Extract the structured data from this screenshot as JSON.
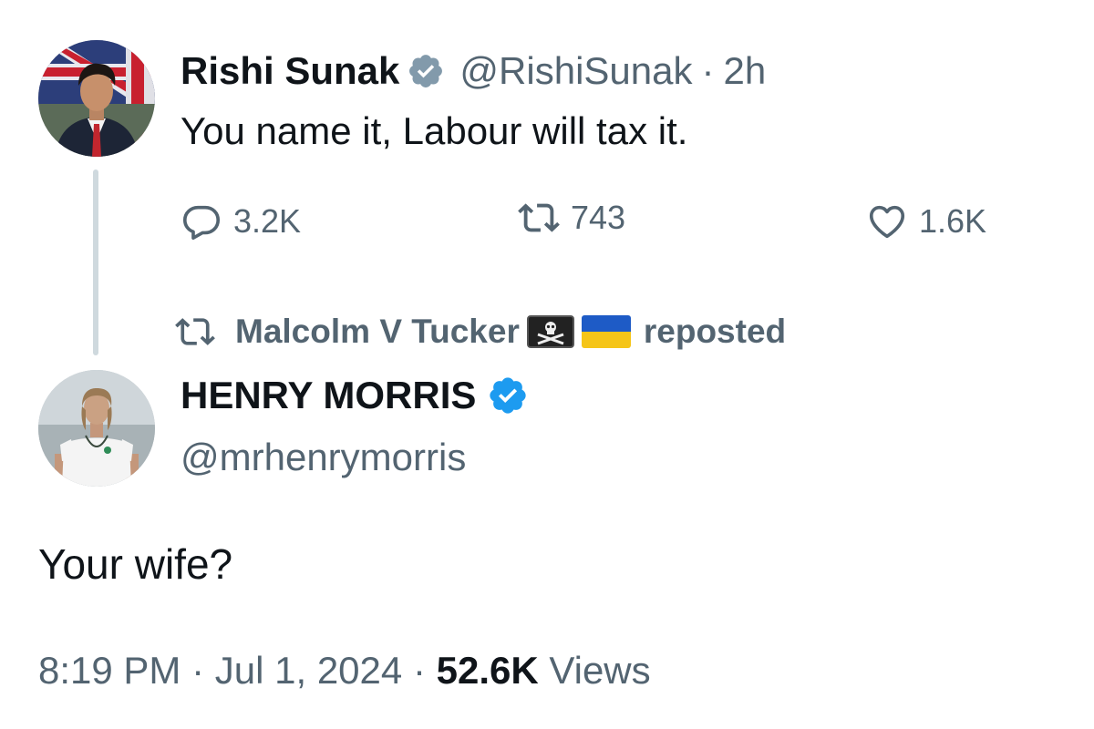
{
  "original_tweet": {
    "author_name": "Rishi Sunak",
    "handle": "@RishiSunak",
    "separator": "·",
    "time_ago": "2h",
    "text": "You name it, Labour will tax it.",
    "verified_badge": "grey-verified-icon",
    "stats": {
      "replies": "3.2K",
      "reposts": "743",
      "likes": "1.6K"
    }
  },
  "repost_banner": {
    "reposter_name": "Malcolm V Tucker",
    "emojis": [
      "pirate-flag-emoji",
      "ukraine-flag-emoji"
    ],
    "action_text": "reposted"
  },
  "reply_tweet": {
    "author_name": "HENRY MORRIS",
    "handle": "@mrhenrymorris",
    "verified_badge": "blue-verified-icon",
    "text": "Your wife?",
    "time": "8:19 PM",
    "separator": "·",
    "date": "Jul 1, 2024",
    "views_count": "52.6K",
    "views_label": "Views"
  },
  "colors": {
    "text_primary": "#0f1419",
    "text_secondary": "#536471",
    "verified_blue": "#1d9bf0",
    "verified_grey": "#829aab",
    "thread_line": "#cfd9de"
  }
}
